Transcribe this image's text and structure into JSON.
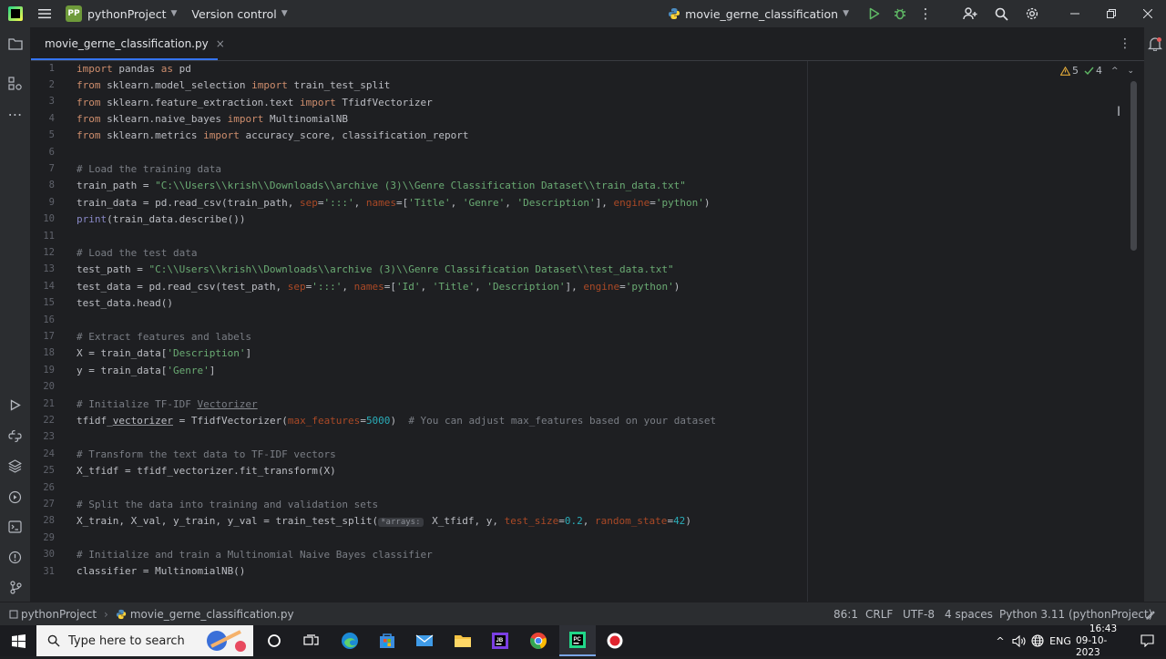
{
  "titlebar": {
    "project_badge": "PP",
    "project_name": "pythonProject",
    "vcs_label": "Version control",
    "run_config": "movie_gerne_classification"
  },
  "editor_tab": {
    "filename": "movie_gerne_classification.py"
  },
  "inspections": {
    "warnings": "5",
    "checks": "4"
  },
  "code_lines": [
    "1",
    "2",
    "3",
    "4",
    "5",
    "6",
    "7",
    "8",
    "9",
    "10",
    "11",
    "12",
    "13",
    "14",
    "15",
    "16",
    "17",
    "18",
    "19",
    "20",
    "21",
    "22",
    "23",
    "24",
    "25",
    "26",
    "27",
    "28",
    "29",
    "30",
    "31"
  ],
  "code": {
    "l1": {
      "a": "import",
      "b": " pandas ",
      "c": "as",
      "d": " pd"
    },
    "l2": {
      "a": "from",
      "b": " sklearn.model_selection ",
      "c": "import",
      "d": " train_test_split"
    },
    "l3": {
      "a": "from",
      "b": " sklearn.feature_extraction.text ",
      "c": "import",
      "d": " TfidfVectorizer"
    },
    "l4": {
      "a": "from",
      "b": " sklearn.naive_bayes ",
      "c": "import",
      "d": " MultinomialNB"
    },
    "l5": {
      "a": "from",
      "b": " sklearn.metrics ",
      "c": "import",
      "d": " accuracy_score, classification_report"
    },
    "l7": "# Load the training data",
    "l8": {
      "a": "train_path = ",
      "b": "\"C:\\\\Users\\\\krish\\\\Downloads\\\\archive (3)\\\\Genre Classification Dataset\\\\train_data.txt\""
    },
    "l9": {
      "a": "train_data = pd.read_csv(train_path, ",
      "b": "sep",
      "c": "=",
      "d": "':::'",
      "e": ", ",
      "f": "names",
      "g": "=[",
      "h": "'Title'",
      "i": ", ",
      "j": "'Genre'",
      "k": ", ",
      "l": "'Description'",
      "m": "], ",
      "n": "engine",
      "o": "=",
      "p": "'python'",
      "q": ")"
    },
    "l10": {
      "a": "print",
      "b": "(train_data.describe())"
    },
    "l12": "# Load the test data",
    "l13": {
      "a": "test_path = ",
      "b": "\"C:\\\\Users\\\\krish\\\\Downloads\\\\archive (3)\\\\Genre Classification Dataset\\\\test_data.txt\""
    },
    "l14": {
      "a": "test_data = pd.read_csv(test_path, ",
      "b": "sep",
      "c": "=",
      "d": "':::'",
      "e": ", ",
      "f": "names",
      "g": "=[",
      "h": "'Id'",
      "i": ", ",
      "j": "'Title'",
      "k": ", ",
      "l": "'Description'",
      "m": "], ",
      "n": "engine",
      "o": "=",
      "p": "'python'",
      "q": ")"
    },
    "l15": "test_data.head()",
    "l17": "# Extract features and labels",
    "l18": {
      "a": "X = train_data[",
      "b": "'Description'",
      "c": "]"
    },
    "l19": {
      "a": "y = train_data[",
      "b": "'Genre'",
      "c": "]"
    },
    "l21": {
      "a": "# Initialize TF-IDF ",
      "b": "Vectorizer"
    },
    "l22": {
      "a": "tfidf_",
      "b": "vectorizer",
      "c": " = TfidfVectorizer(",
      "d": "max_features",
      "e": "=",
      "f": "5000",
      "g": ")  ",
      "h": "# You can adjust max_features based on your dataset"
    },
    "l24": "# Transform the text data to TF-IDF vectors",
    "l25": "X_tfidf = tfidf_vectorizer.fit_transform(X)",
    "l27": "# Split the data into training and validation sets",
    "l28": {
      "a": "X_train, X_val, y_train, y_val = train_test_split(",
      "hint": "*arrays:",
      "b": " X_tfidf, y, ",
      "c": "test_size",
      "d": "=",
      "e": "0.2",
      "f": ", ",
      "g": "random_state",
      "h": "=",
      "i": "42",
      "j": ")"
    },
    "l30": "# Initialize and train a Multinomial Naive Bayes classifier",
    "l31": "classifier = MultinomialNB()"
  },
  "statusbar": {
    "breadcrumb_project": "pythonProject",
    "breadcrumb_file": "movie_gerne_classification.py",
    "position": "86:1",
    "line_sep": "CRLF",
    "encoding": "UTF-8",
    "indent": "4 spaces",
    "interpreter": "Python 3.11 (pythonProject)"
  },
  "taskbar": {
    "search_placeholder": "Type here to search",
    "lang": "ENG",
    "time": "16:43",
    "date": "09-10-2023"
  }
}
